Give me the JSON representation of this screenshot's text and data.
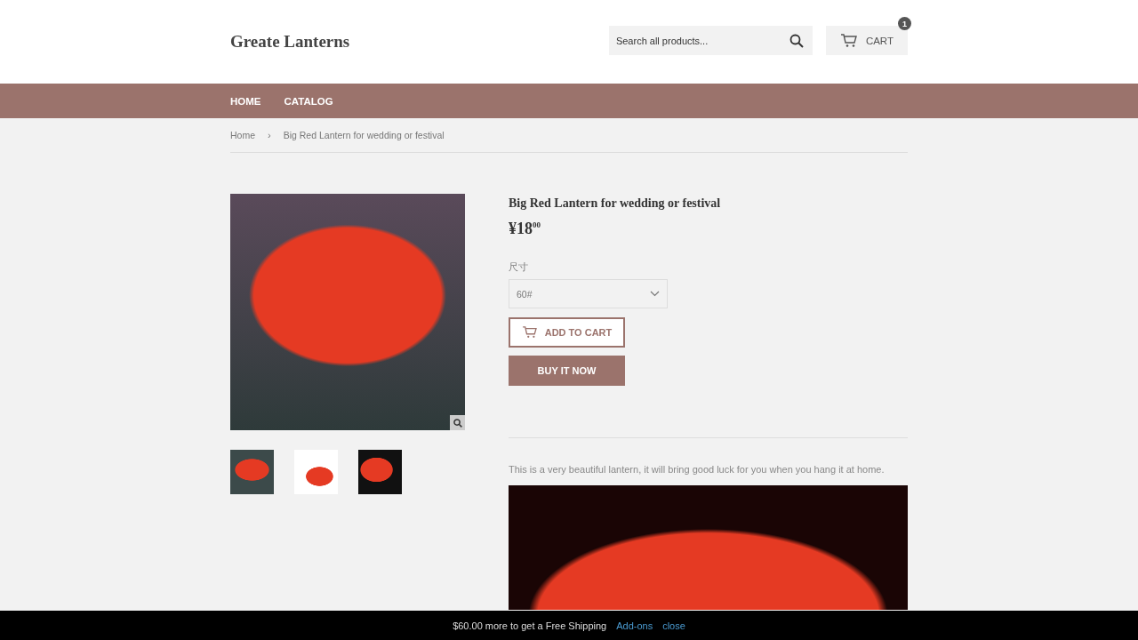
{
  "header": {
    "logo": "Greate Lanterns",
    "search": {
      "placeholder": "Search all products..."
    },
    "cart": {
      "label": "CART",
      "count": "1"
    }
  },
  "nav": [
    "HOME",
    "CATALOG"
  ],
  "breadcrumb": [
    "Home",
    "›",
    "Big Red Lantern for wedding or festival"
  ],
  "product": {
    "title": "Big Red Lantern for wedding or festival",
    "price": "¥18$^{00}$",
    "option_label": "尺寸",
    "option_value": "60#",
    "add_to_cart": "ADD TO CART",
    "buy_now": "BUY IT NOW",
    "description": "This is a very beautiful lantern, it will bring good luck for you when you hang it at home.",
    "thumbnails": [
      {
        "kind": "scene"
      },
      {
        "kind": "white"
      },
      {
        "kind": "dark"
      }
    ]
  },
  "shipping_bar": {
    "message": "$60.00 more to get a Free Shipping",
    "links": [
      "Add-ons",
      "close"
    ]
  }
}
